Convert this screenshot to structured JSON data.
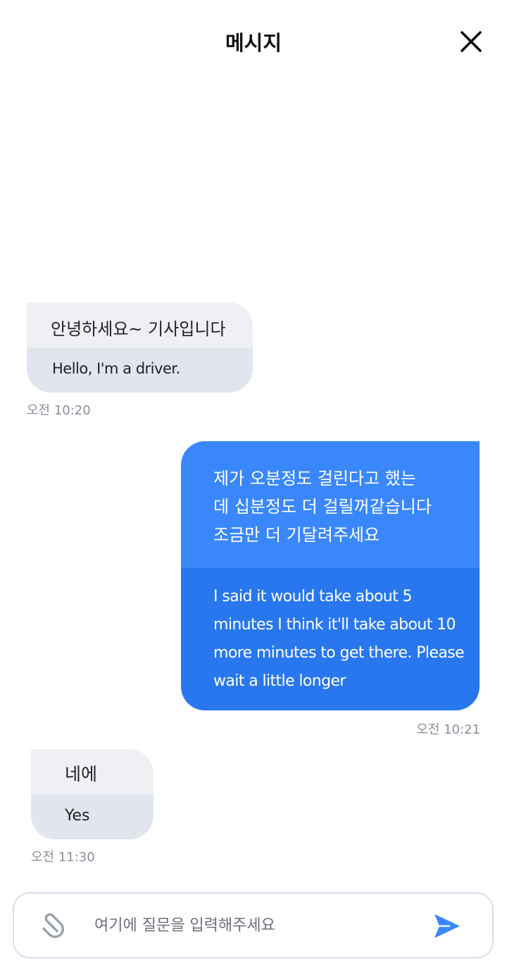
{
  "header": {
    "title": "메시지"
  },
  "messages": [
    {
      "direction": "incoming",
      "original": "안녕하세요~ 기사입니다",
      "translation": "Hello, I'm a driver.",
      "time": "오전 10:20"
    },
    {
      "direction": "outgoing",
      "original_lines": [
        "제가 오분정도 걸린다고 했는",
        "데 십분정도 더 걸릴꺼같습니다",
        "조금만 더 기달려주세요"
      ],
      "translation_lines": [
        "I said it would take about 5",
        "minutes I think it'll take about 10",
        "more minutes to get there. Please",
        "wait a little longer"
      ],
      "time": "오전 10:21"
    },
    {
      "direction": "incoming",
      "original": "네에",
      "translation": "Yes",
      "time": "오전 11:30"
    }
  ],
  "composer": {
    "placeholder": "여기에 질문을 입력해주세요",
    "value": ""
  },
  "icons": {
    "close": "close-icon",
    "attach": "paperclip-icon",
    "send": "send-icon"
  },
  "colors": {
    "outgoing_original_bg": "#3a87fc",
    "outgoing_translation_bg": "#2877ee",
    "incoming_original_bg": "#eef0f4",
    "incoming_translation_bg": "#e0e5ee",
    "send_icon": "#3a87fc",
    "attach_icon": "#9aa1ab"
  }
}
